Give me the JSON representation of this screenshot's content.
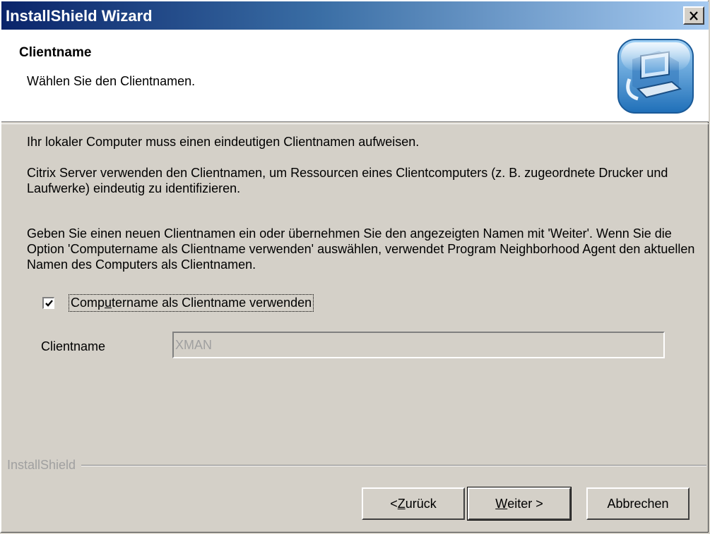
{
  "window": {
    "title": "InstallShield Wizard",
    "close_label": "✕"
  },
  "header": {
    "title": "Clientname",
    "subtitle": "Wählen Sie den Clientnamen.",
    "icon": "computer-setup-icon"
  },
  "body": {
    "paragraph1": "Ihr lokaler Computer muss einen eindeutigen Clientnamen aufweisen.",
    "paragraph2": "Citrix Server verwenden den Clientnamen, um Ressourcen eines Clientcomputers (z. B. zugeordnete Drucker und Laufwerke) eindeutig zu identifizieren.",
    "paragraph3": "Geben Sie einen neuen Clientnamen ein oder übernehmen Sie den angezeigten Namen mit 'Weiter'. Wenn Sie die Option 'Computername als Clientname verwenden' auswählen, verwendet Program Neighborhood Agent den aktuellen Namen des Computers als Clientnamen."
  },
  "checkbox": {
    "label_pre": "Comp",
    "label_accel": "u",
    "label_post": "tername als Clientname verwenden",
    "checked": true
  },
  "clientname": {
    "label": "Clientname",
    "value": "XMAN",
    "disabled": true
  },
  "footer": {
    "brand": "InstallShield"
  },
  "buttons": {
    "back_pre": "< ",
    "back_accel": "Z",
    "back_post": "urück",
    "next_accel": "W",
    "next_post": "eiter >",
    "cancel": "Abbrechen"
  },
  "colors": {
    "title_gradient_start": "#0a246a",
    "title_gradient_end": "#a6caf0",
    "face": "#d4d0c8"
  }
}
